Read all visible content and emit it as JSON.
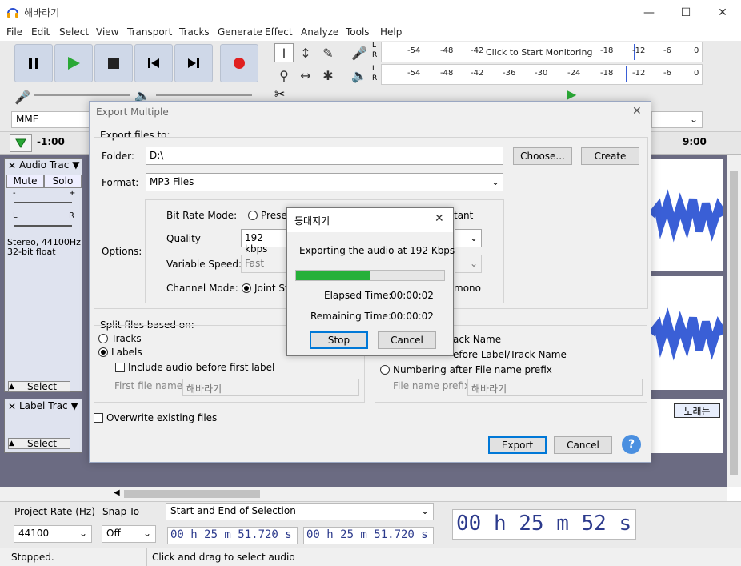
{
  "window": {
    "title": "해바라기",
    "icons": {
      "app": "headphones-icon",
      "minimize": "minimize-icon",
      "maximize": "maximize-icon",
      "close": "close-icon"
    }
  },
  "menu": [
    "File",
    "Edit",
    "Select",
    "View",
    "Transport",
    "Tracks",
    "Generate",
    "Effect",
    "Analyze",
    "Tools",
    "Help"
  ],
  "meters": {
    "record_ticks": [
      "-54",
      "-48",
      "-42",
      "Click to Start Monitoring",
      "-18",
      "-12",
      "-6",
      "0"
    ],
    "playback_ticks": [
      "-54",
      "-48",
      "-42",
      "-36",
      "-30",
      "-24",
      "-18",
      "-12",
      "-6",
      "0"
    ],
    "channel_l": "L",
    "channel_r": "R"
  },
  "device": {
    "host": "MME"
  },
  "timeline": {
    "start": "-1:00",
    "end": "9:00"
  },
  "tracks": {
    "audio": {
      "name": "Audio Trac",
      "mute": "Mute",
      "solo": "Solo",
      "gain_minus": "-",
      "gain_plus": "+",
      "pan_l": "L",
      "pan_r": "R",
      "info_line1": "Stereo, 44100Hz",
      "info_line2": "32-bit float",
      "select": "Select"
    },
    "label": {
      "name": "Label Trac",
      "select": "Select",
      "label_text": "노래는"
    }
  },
  "selection_bar": {
    "project_rate_label": "Project Rate (Hz)",
    "snap_to_label": "Snap-To",
    "project_rate": "44100",
    "snap_to": "Off",
    "selection_mode": "Start and End of Selection",
    "start_time": "00 h 25 m 51.720 s",
    "end_time": "00 h 25 m 51.720 s",
    "audio_position": "00 h 25 m 52 s"
  },
  "status": {
    "left": "Stopped.",
    "right": "Click and drag to select audio"
  },
  "export_dialog": {
    "title": "Export Multiple",
    "export_files_to": "Export files to:",
    "folder_label": "Folder:",
    "folder_value": "D:\\",
    "choose_button": "Choose...",
    "create_button": "Create",
    "format_label": "Format:",
    "format_value": "MP3 Files",
    "options_label": "Options:",
    "bit_rate_mode_label": "Bit Rate Mode:",
    "preset_radio": "Preset",
    "constant_radio": "tant",
    "quality_label": "Quality",
    "quality_value": "192 kbps",
    "variable_speed_label": "Variable Speed:",
    "variable_speed_value": "Fast",
    "channel_mode_label": "Channel Mode:",
    "joint_stereo_radio": "Joint St",
    "mono_text": "mono",
    "split_group": "Split files based on:",
    "tracks_radio": "Tracks",
    "labels_radio": "Labels",
    "include_audio_check": "Include audio before first label",
    "first_file_name_label": "First file name:",
    "first_file_name_value": "해바라기",
    "name_track_text": "ack Name",
    "numbering_before_text": "efore Label/Track Name",
    "numbering_after_radio": "Numbering after File name prefix",
    "file_name_prefix_label": "File name prefix:",
    "file_name_prefix_value": "해바라기",
    "overwrite_check": "Overwrite existing files",
    "export_button": "Export",
    "cancel_button": "Cancel",
    "help_button": "?"
  },
  "progress_dialog": {
    "title": "등대지기",
    "message": "Exporting the audio at 192 Kbps",
    "progress": 0.5,
    "elapsed_label": "Elapsed Time:",
    "elapsed_value": "00:00:02",
    "remaining_label": "Remaining Time:",
    "remaining_value": "00:00:02",
    "stop_button": "Stop",
    "cancel_button": "Cancel"
  },
  "colors": {
    "accent": "#0078d7",
    "progress": "#26b03a",
    "timecode": "#2c3a8c",
    "waveform": "#3a5fd6"
  }
}
